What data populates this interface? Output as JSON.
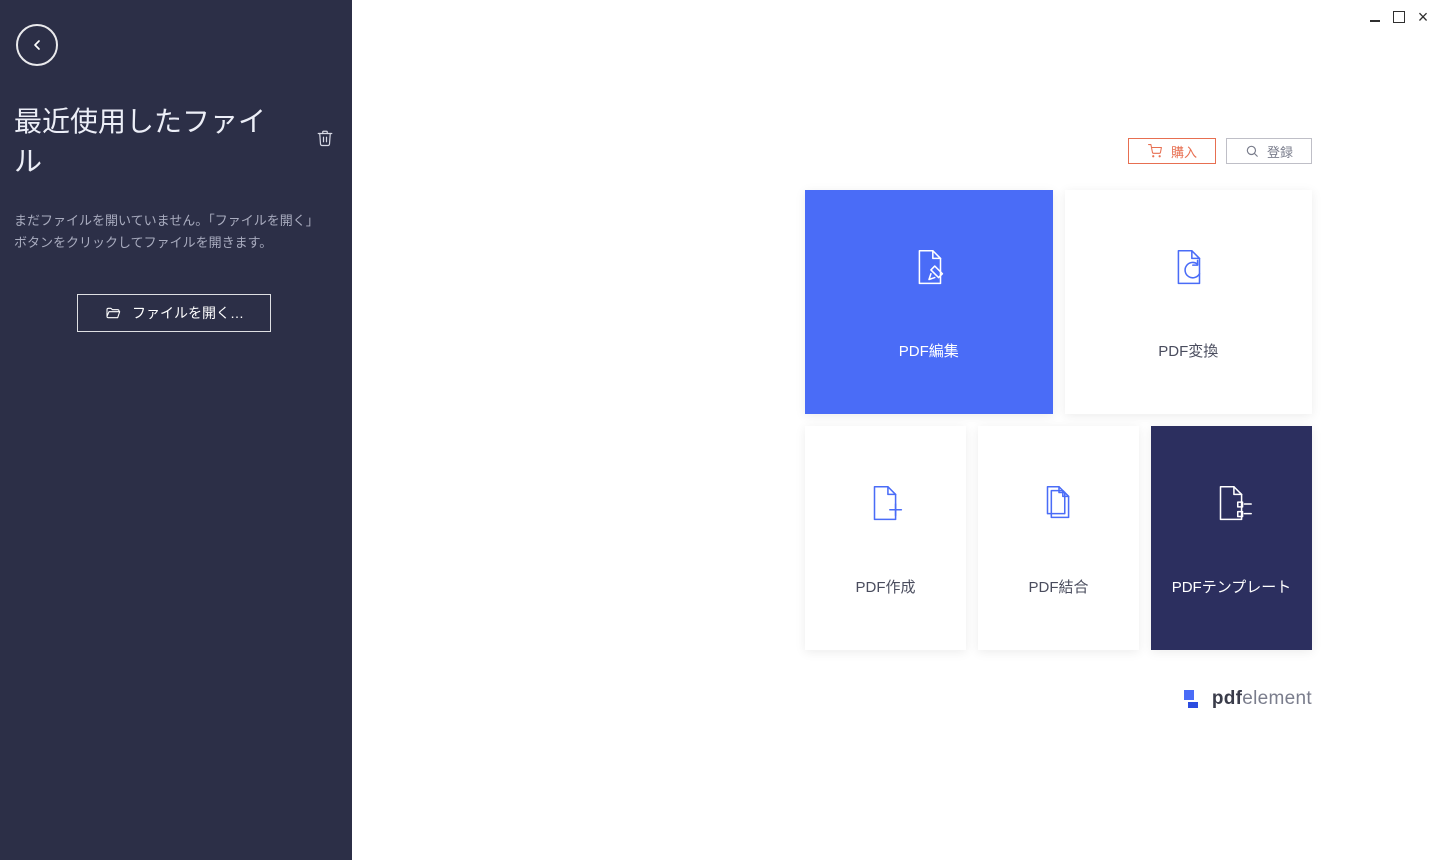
{
  "sidebar": {
    "title": "最近使用したファイル",
    "description": "まだファイルを開いていません。「ファイルを開く」ボタンをクリックしてファイルを開きます。",
    "open_file_label": "ファイルを開く…"
  },
  "top_actions": {
    "buy_label": "購入",
    "register_label": "登録"
  },
  "tiles": [
    {
      "label": "PDF編集",
      "icon": "edit",
      "variant": "blue"
    },
    {
      "label": "PDF変換",
      "icon": "convert",
      "variant": "white"
    },
    {
      "label": "PDF作成",
      "icon": "create",
      "variant": "white"
    },
    {
      "label": "PDF結合",
      "icon": "merge",
      "variant": "white"
    },
    {
      "label": "PDFテンプレート",
      "icon": "template",
      "variant": "navy"
    }
  ],
  "brand": {
    "bold": "pdf",
    "rest": "element"
  },
  "colors": {
    "accent_blue": "#4a6cf7",
    "dark_navy": "#2c2f5f",
    "orange": "#e76f51",
    "sidebar_bg": "#2c2f47"
  }
}
